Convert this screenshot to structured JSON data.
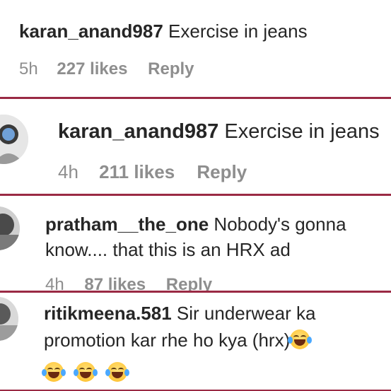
{
  "comments": [
    {
      "username": "karan_anand987",
      "text": "Exercise in jeans",
      "time": "5h",
      "likes": "227 likes",
      "reply": "Reply"
    },
    {
      "username": "karan_anand987",
      "text": "Exercise in jeans",
      "time": "4h",
      "likes": "211 likes",
      "reply": "Reply"
    },
    {
      "username": "pratham__the_one",
      "text": "Nobody's gonna know.... that this is an HRX ad",
      "time": "4h",
      "likes": "87 likes",
      "reply": "Reply"
    },
    {
      "username": "ritikmeena.581",
      "text": "Sir underwear ka promotion kar rhe ho kya (hrx)",
      "time": "",
      "likes": "",
      "reply": ""
    }
  ],
  "emoji_icon": "rolling-on-floor-laughing-emoji",
  "colors": {
    "border": "#9a2a44",
    "text": "#262626",
    "meta": "#8e8e8e"
  }
}
